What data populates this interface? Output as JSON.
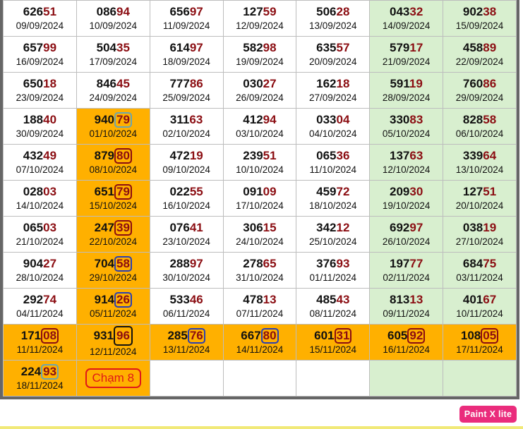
{
  "rows": [
    [
      {
        "head": "626",
        "tail": "51",
        "date": "09/09/2024"
      },
      {
        "head": "086",
        "tail": "94",
        "date": "10/09/2024"
      },
      {
        "head": "656",
        "tail": "97",
        "date": "11/09/2024"
      },
      {
        "head": "127",
        "tail": "59",
        "date": "12/09/2024"
      },
      {
        "head": "506",
        "tail": "28",
        "date": "13/09/2024"
      },
      {
        "head": "043",
        "tail": "32",
        "date": "14/09/2024"
      },
      {
        "head": "902",
        "tail": "38",
        "date": "15/09/2024"
      }
    ],
    [
      {
        "head": "657",
        "tail": "99",
        "date": "16/09/2024"
      },
      {
        "head": "504",
        "tail": "35",
        "date": "17/09/2024"
      },
      {
        "head": "614",
        "tail": "97",
        "date": "18/09/2024"
      },
      {
        "head": "582",
        "tail": "98",
        "date": "19/09/2024"
      },
      {
        "head": "635",
        "tail": "57",
        "date": "20/09/2024"
      },
      {
        "head": "579",
        "tail": "17",
        "date": "21/09/2024"
      },
      {
        "head": "458",
        "tail": "89",
        "date": "22/09/2024"
      }
    ],
    [
      {
        "head": "650",
        "tail": "18",
        "date": "23/09/2024"
      },
      {
        "head": "846",
        "tail": "45",
        "date": "24/09/2024"
      },
      {
        "head": "777",
        "tail": "86",
        "date": "25/09/2024"
      },
      {
        "head": "030",
        "tail": "27",
        "date": "26/09/2024"
      },
      {
        "head": "162",
        "tail": "18",
        "date": "27/09/2024"
      },
      {
        "head": "591",
        "tail": "19",
        "date": "28/09/2024"
      },
      {
        "head": "760",
        "tail": "86",
        "date": "29/09/2024"
      }
    ],
    [
      {
        "head": "188",
        "tail": "40",
        "date": "30/09/2024"
      },
      {
        "head": "940",
        "tail": "79",
        "date": "01/10/2024",
        "hl": true,
        "box": "teal"
      },
      {
        "head": "311",
        "tail": "63",
        "date": "02/10/2024"
      },
      {
        "head": "412",
        "tail": "94",
        "date": "03/10/2024"
      },
      {
        "head": "033",
        "tail": "04",
        "date": "04/10/2024"
      },
      {
        "head": "330",
        "tail": "83",
        "date": "05/10/2024"
      },
      {
        "head": "828",
        "tail": "58",
        "date": "06/10/2024"
      }
    ],
    [
      {
        "head": "432",
        "tail": "49",
        "date": "07/10/2024"
      },
      {
        "head": "879",
        "tail": "80",
        "date": "08/10/2024",
        "hl": true,
        "box": "red"
      },
      {
        "head": "472",
        "tail": "19",
        "date": "09/10/2024"
      },
      {
        "head": "239",
        "tail": "51",
        "date": "10/10/2024"
      },
      {
        "head": "065",
        "tail": "36",
        "date": "11/10/2024"
      },
      {
        "head": "137",
        "tail": "63",
        "date": "12/10/2024"
      },
      {
        "head": "339",
        "tail": "64",
        "date": "13/10/2024"
      }
    ],
    [
      {
        "head": "028",
        "tail": "03",
        "date": "14/10/2024"
      },
      {
        "head": "651",
        "tail": "79",
        "date": "15/10/2024",
        "hl": true,
        "box": "red"
      },
      {
        "head": "022",
        "tail": "55",
        "date": "16/10/2024"
      },
      {
        "head": "091",
        "tail": "09",
        "date": "17/10/2024"
      },
      {
        "head": "459",
        "tail": "72",
        "date": "18/10/2024"
      },
      {
        "head": "209",
        "tail": "30",
        "date": "19/10/2024"
      },
      {
        "head": "127",
        "tail": "51",
        "date": "20/10/2024"
      }
    ],
    [
      {
        "head": "065",
        "tail": "03",
        "date": "21/10/2024"
      },
      {
        "head": "247",
        "tail": "39",
        "date": "22/10/2024",
        "hl": true,
        "box": "red"
      },
      {
        "head": "076",
        "tail": "41",
        "date": "23/10/2024"
      },
      {
        "head": "306",
        "tail": "15",
        "date": "24/10/2024"
      },
      {
        "head": "342",
        "tail": "12",
        "date": "25/10/2024"
      },
      {
        "head": "692",
        "tail": "97",
        "date": "26/10/2024"
      },
      {
        "head": "038",
        "tail": "19",
        "date": "27/10/2024"
      }
    ],
    [
      {
        "head": "904",
        "tail": "27",
        "date": "28/10/2024"
      },
      {
        "head": "704",
        "tail": "58",
        "date": "29/10/2024",
        "hl": true,
        "box": "blue"
      },
      {
        "head": "288",
        "tail": "97",
        "date": "30/10/2024"
      },
      {
        "head": "278",
        "tail": "65",
        "date": "31/10/2024"
      },
      {
        "head": "376",
        "tail": "93",
        "date": "01/11/2024"
      },
      {
        "head": "197",
        "tail": "77",
        "date": "02/11/2024"
      },
      {
        "head": "684",
        "tail": "75",
        "date": "03/11/2024"
      }
    ],
    [
      {
        "head": "292",
        "tail": "74",
        "date": "04/11/2024"
      },
      {
        "head": "914",
        "tail": "26",
        "date": "05/11/2024",
        "hl": true,
        "box": "blue"
      },
      {
        "head": "533",
        "tail": "46",
        "date": "06/11/2024"
      },
      {
        "head": "478",
        "tail": "13",
        "date": "07/11/2024"
      },
      {
        "head": "485",
        "tail": "43",
        "date": "08/11/2024"
      },
      {
        "head": "813",
        "tail": "13",
        "date": "09/11/2024"
      },
      {
        "head": "401",
        "tail": "67",
        "date": "10/11/2024"
      }
    ],
    [
      {
        "head": "171",
        "tail": "08",
        "date": "11/11/2024",
        "hl": true,
        "box": "red"
      },
      {
        "head": "931",
        "tail": "96",
        "date": "12/11/2024",
        "hl": true,
        "box": "black"
      },
      {
        "head": "285",
        "tail": "76",
        "date": "13/11/2024",
        "hl": true,
        "box": "blue"
      },
      {
        "head": "667",
        "tail": "80",
        "date": "14/11/2024",
        "hl": true,
        "box": "blue"
      },
      {
        "head": "601",
        "tail": "31",
        "date": "15/11/2024",
        "hl": true,
        "box": "red"
      },
      {
        "head": "605",
        "tail": "92",
        "date": "16/11/2024",
        "hl": true,
        "box": "red"
      },
      {
        "head": "108",
        "tail": "05",
        "date": "17/11/2024",
        "hl": true,
        "box": "red"
      }
    ],
    [
      {
        "head": "224",
        "tail": "93",
        "date": "18/11/2024",
        "hl": true,
        "box": "teal"
      },
      {
        "note": "Chạm 8",
        "hl": true
      },
      {
        "empty": true
      },
      {
        "empty": true
      },
      {
        "empty": true
      },
      {
        "empty": true
      },
      {
        "empty": true
      }
    ]
  ],
  "badge": {
    "label": "Paint X lite"
  },
  "colors": {
    "highlight": "#ffb000",
    "weekend": "#d8efcf",
    "tail": "#8b0d12",
    "badge": "#ea2c7c"
  }
}
